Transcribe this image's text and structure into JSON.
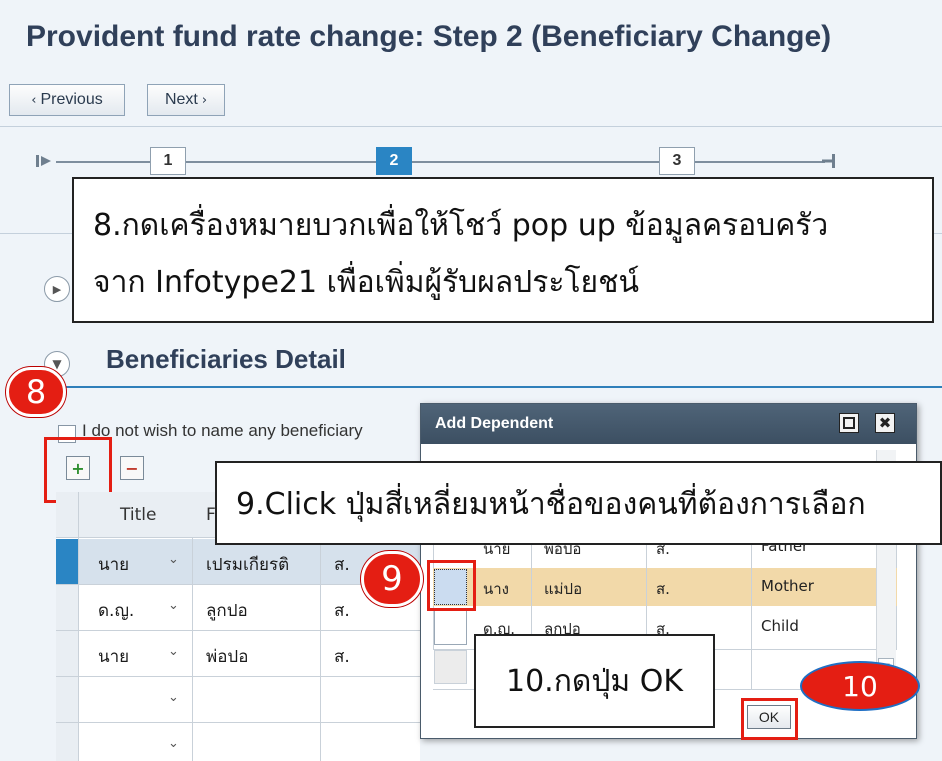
{
  "page": {
    "title": "Provident fund rate change: Step 2 (Beneficiary Change)"
  },
  "nav": {
    "previous": "Previous",
    "next": "Next",
    "prev_glyph": "‹",
    "next_glyph": "›"
  },
  "steps": [
    {
      "label": "1"
    },
    {
      "label": "2",
      "active": true
    },
    {
      "label": "3"
    }
  ],
  "callouts": {
    "c8_line1": "8.กดเครื่องหมายบวกเพื่อให้โชว์ pop up ข้อมูลครอบครัว",
    "c8_line2": "จาก Infotype21 เพื่อเพิ่มผู้รับผลประโยชน์",
    "c9": "9.Click ปุ่มสี่เหลี่ยมหน้าชื่อของคนที่ต้องการเลือก",
    "c10": "10.กดปุ่ม OK"
  },
  "badges": {
    "b8": "8",
    "b9": "9",
    "b10": "10"
  },
  "section": {
    "title": "Beneficiaries Detail"
  },
  "checkbox": {
    "label": "I do not wish to name any beneficiary"
  },
  "table": {
    "headers": {
      "title": "Title",
      "first": "F"
    },
    "rows": [
      {
        "title": "นาย",
        "first": "เปรมเกียรติ",
        "last": "ส."
      },
      {
        "title": "ด.ญ.",
        "first": "ลูกปอ",
        "last": "ส."
      },
      {
        "title": "นาย",
        "first": "พ่อปอ",
        "last": "ส."
      },
      {
        "title": "",
        "first": "",
        "last": ""
      },
      {
        "title": "",
        "first": "",
        "last": ""
      }
    ]
  },
  "dialog": {
    "title": "Add Dependent",
    "rows": [
      {
        "title": "นาย",
        "first": "พ่อปอ",
        "last": "ส.",
        "relation": "Father"
      },
      {
        "title": "นาง",
        "first": "แม่ปอ",
        "last": "ส.",
        "relation": "Mother"
      },
      {
        "title": "ด.ญ.",
        "first": "ลูกปอ",
        "last": "ส.",
        "relation": "Child"
      }
    ],
    "ok_label": "OK"
  },
  "colors": {
    "accent": "#2a85c4",
    "badge": "#e41e13",
    "selected_row": "#f2d9a9"
  }
}
